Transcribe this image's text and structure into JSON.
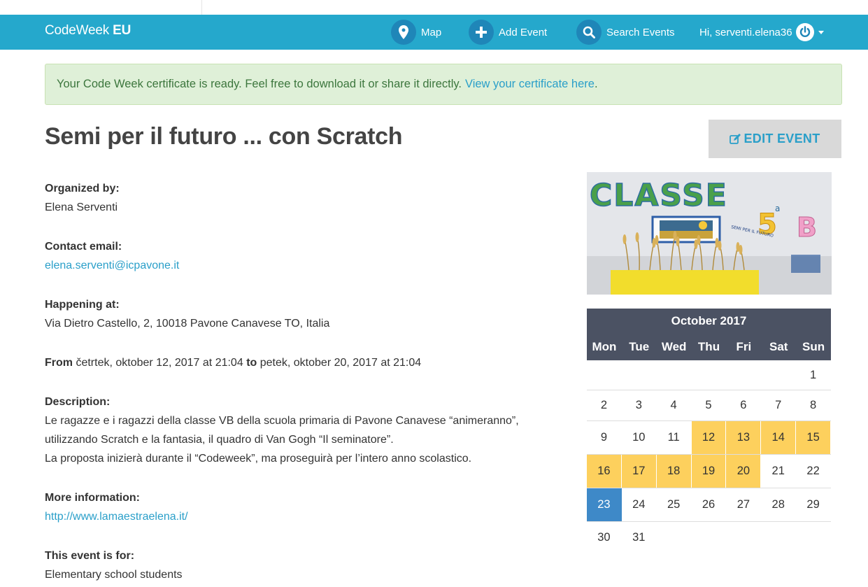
{
  "navbar": {
    "brand_prefix": "CodeWeek",
    "brand_suffix": "EU",
    "map_label": "Map",
    "add_event_label": "Add Event",
    "search_label": "Search Events",
    "user_greeting": "Hi, serventi.elena36"
  },
  "alert": {
    "message": "Your Code Week certificate is ready. Feel free to download it or share it directly.",
    "link_text": "View your certificate here",
    "suffix": "."
  },
  "event": {
    "title": "Semi per il futuro ... con Scratch",
    "edit_label": "EDIT EVENT",
    "organized_label": "Organized by:",
    "organizer": "Elena Serventi",
    "contact_label": "Contact email:",
    "email": "elena.serventi@icpavone.it",
    "location_label": "Happening at:",
    "location": "Via Dietro Castello, 2, 10018 Pavone Canavese TO, Italia",
    "from_label": "From",
    "from_date": "četrtek, oktober 12, 2017 at 21:04",
    "to_label": "to",
    "to_date": "petek, oktober 20, 2017 at 21:04",
    "description_label": "Description:",
    "description_lines": [
      "Le ragazze e i ragazzi della classe VB della scuola primaria di Pavone Canavese “animeranno”,",
      "utilizzando Scratch e la fantasia, il quadro di Van Gogh “Il seminatore”.",
      "La proposta inizierà durante il “Codeweek”, ma proseguirà per l’intero anno scolastico."
    ],
    "more_info_label": "More information:",
    "more_info_url": "http://www.lamaestraelena.it/",
    "audience_label": "This event is for:",
    "audience": "Elementary school students",
    "image_text_main": "CLASSE",
    "image_text_class": "5",
    "image_text_sup": "a",
    "image_text_section": "B",
    "image_text_sign": "SEMI PER IL FUTURO"
  },
  "calendar": {
    "title": "October 2017",
    "weekdays": [
      "Mon",
      "Tue",
      "Wed",
      "Thu",
      "Fri",
      "Sat",
      "Sun"
    ],
    "weeks": [
      [
        "",
        "",
        "",
        "",
        "",
        "",
        "1"
      ],
      [
        "2",
        "3",
        "4",
        "5",
        "6",
        "7",
        "8"
      ],
      [
        "9",
        "10",
        "11",
        "12",
        "13",
        "14",
        "15"
      ],
      [
        "16",
        "17",
        "18",
        "19",
        "20",
        "21",
        "22"
      ],
      [
        "23",
        "24",
        "25",
        "26",
        "27",
        "28",
        "29"
      ],
      [
        "30",
        "31",
        "",
        "",
        "",
        "",
        ""
      ]
    ],
    "event_days": [
      "12",
      "13",
      "14",
      "15",
      "16",
      "17",
      "18",
      "19",
      "20"
    ],
    "today": "23",
    "event_color": "#fdd05d",
    "today_color": "#3e89c8"
  },
  "colors": {
    "navbar": "#25a8cc",
    "link": "#2a9fc9",
    "calendar_header": "#4b5263"
  }
}
